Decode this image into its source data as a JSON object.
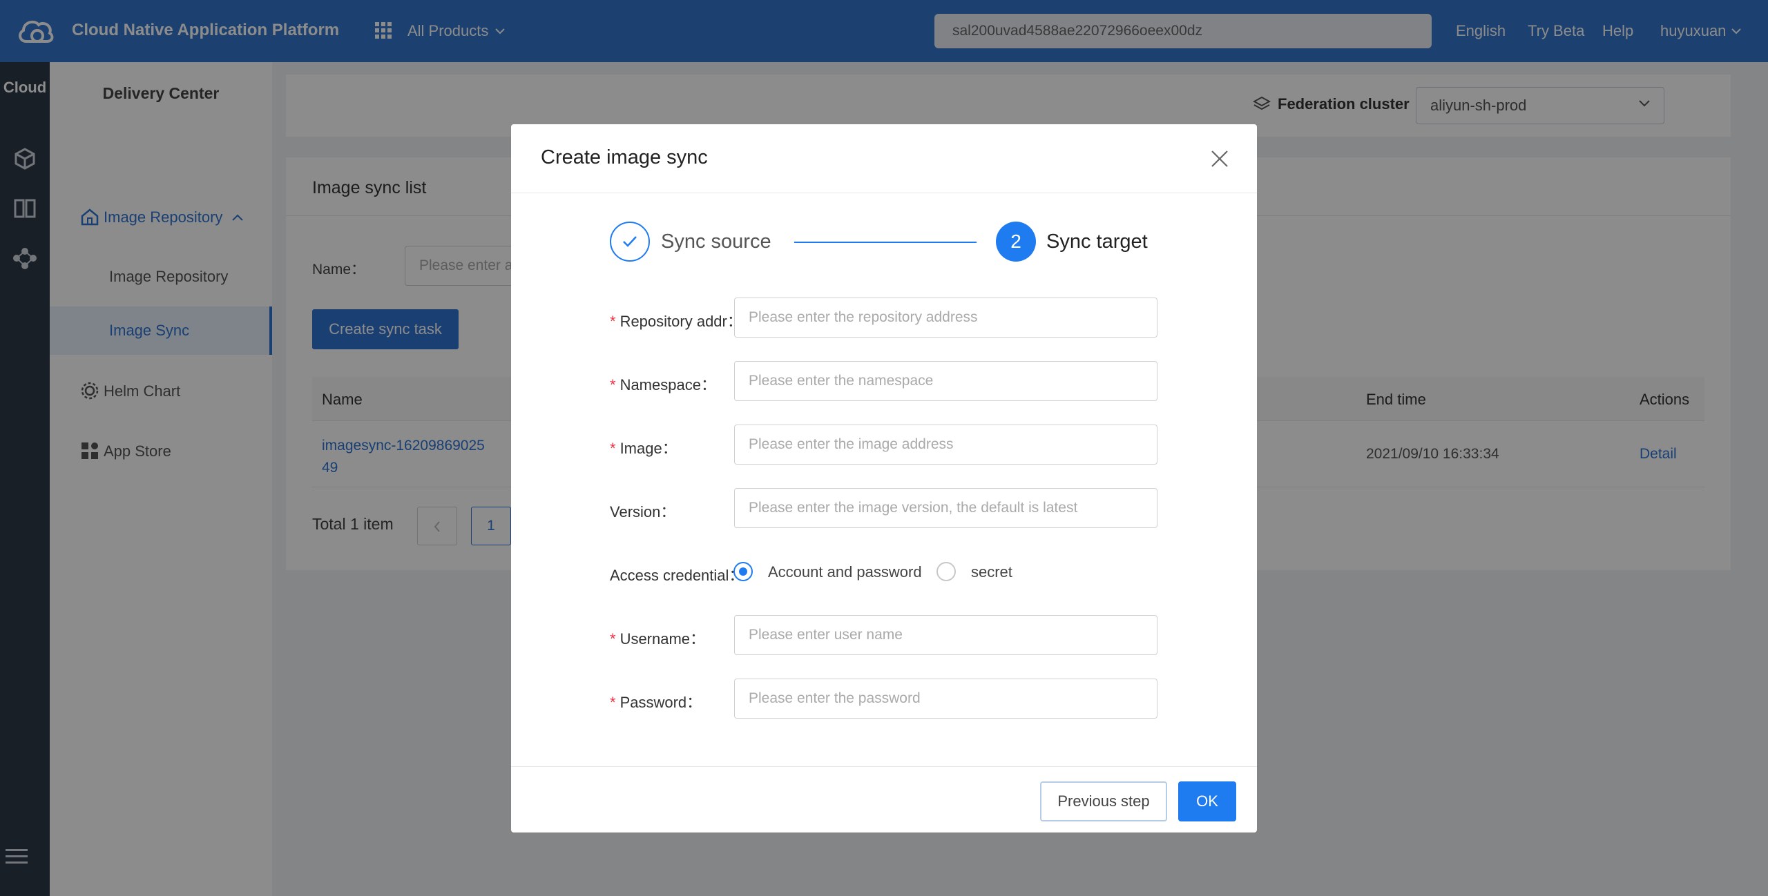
{
  "topbar": {
    "app_title": "Cloud Native Application Platform",
    "products_label": "All Products",
    "search_text": "sal200uvad4588ae22072966oeex00dz",
    "lang": "English",
    "try_beta": "Try Beta",
    "help": "Help",
    "user": "huyuxuan"
  },
  "rail": {
    "cloud_label": "Cloud"
  },
  "sidebar": {
    "header": "Delivery Center",
    "items": [
      {
        "label": "Image Repository"
      },
      {
        "label": "Image Repository"
      },
      {
        "label": "Image Sync"
      },
      {
        "label": "Helm Chart"
      },
      {
        "label": "App Store"
      }
    ]
  },
  "toppanel": {
    "federation_label": "Federation cluster",
    "cluster_value": "aliyun-sh-prod"
  },
  "list": {
    "title": "Image sync list",
    "name_label": "Name：",
    "name_placeholder": "Please enter a",
    "create_button": "Create sync task",
    "columns": {
      "name": "Name",
      "end_time": "End time",
      "actions": "Actions"
    },
    "rows": [
      {
        "name": "imagesync-1620986902549",
        "end_time": "2021/09/10 16:33:34",
        "action": "Detail"
      }
    ],
    "total": "Total 1 item",
    "current_page": "1"
  },
  "modal": {
    "title": "Create image sync",
    "steps": [
      {
        "label": "Sync source"
      },
      {
        "number": "2",
        "label": "Sync target"
      }
    ],
    "fields": {
      "repo_label": "Repository addr：",
      "repo_placeholder": "Please enter the repository address",
      "namespace_label": "Namespace：",
      "namespace_placeholder": "Please enter the namespace",
      "image_label": "Image：",
      "image_placeholder": "Please enter the image address",
      "version_label": "Version：",
      "version_placeholder": "Please enter the image version, the default is latest",
      "credential_label": "Access credential：",
      "credential_option1": "Account and password",
      "credential_option2": "secret",
      "username_label": "Username：",
      "username_placeholder": "Please enter user name",
      "password_label": "Password：",
      "password_placeholder": "Please enter the password"
    },
    "buttons": {
      "previous": "Previous step",
      "ok": "OK"
    }
  },
  "colors": {
    "primary": "#1f7bf0",
    "topbar": "#3376cd",
    "rail": "#2d3a48",
    "required": "#ee3344"
  }
}
